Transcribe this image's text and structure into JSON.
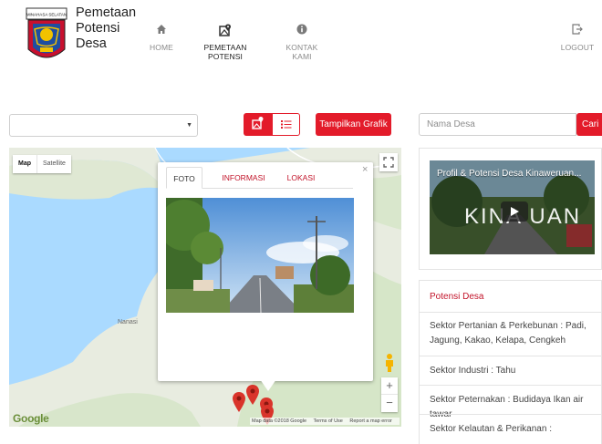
{
  "header": {
    "logo_text": "MINAHASA SELATAN",
    "brand_lines": [
      "Pemetaan",
      "Potensi",
      "Desa"
    ],
    "nav": [
      {
        "label": "HOME",
        "icon": "home-icon"
      },
      {
        "label": "PEMETAAN POTENSI",
        "icon": "map-marker-icon"
      },
      {
        "label": "KONTAK KAMI",
        "icon": "info-icon"
      }
    ],
    "logout_label": "LOGOUT"
  },
  "toolbar": {
    "select_value": "",
    "grafik_label": "Tampilkan Grafik",
    "search_placeholder": "Nama Desa",
    "search_button": "Cari"
  },
  "map": {
    "type_map": "Map",
    "type_satellite": "Satellite",
    "place_label": "Nanasi",
    "logo": "Google",
    "footer": [
      "Map data ©2018 Google",
      "Terms of Use",
      "Report a map error"
    ],
    "zoom_in": "+",
    "zoom_out": "−",
    "infowindow": {
      "tabs": [
        "FOTO",
        "INFORMASI",
        "LOKASI"
      ],
      "active_tab": "FOTO",
      "close": "×"
    }
  },
  "video": {
    "title": "Profil & Potensi Desa Kinaweruan...",
    "overlay_text": "KINA UAN"
  },
  "potensi": {
    "title": "Potensi Desa",
    "items": [
      "Sektor Pertanian & Perkebunan : Padi, Jagung, Kakao, Kelapa, Cengkeh",
      "Sektor Industri : Tahu",
      "Sektor Peternakan : Budidaya Ikan air tawar",
      "Sektor Kelautan & Perikanan :"
    ]
  },
  "colors": {
    "accent": "#e31b2a",
    "accent_text": "#c2142a",
    "water": "#aadaff",
    "land": "#e8ece0"
  }
}
